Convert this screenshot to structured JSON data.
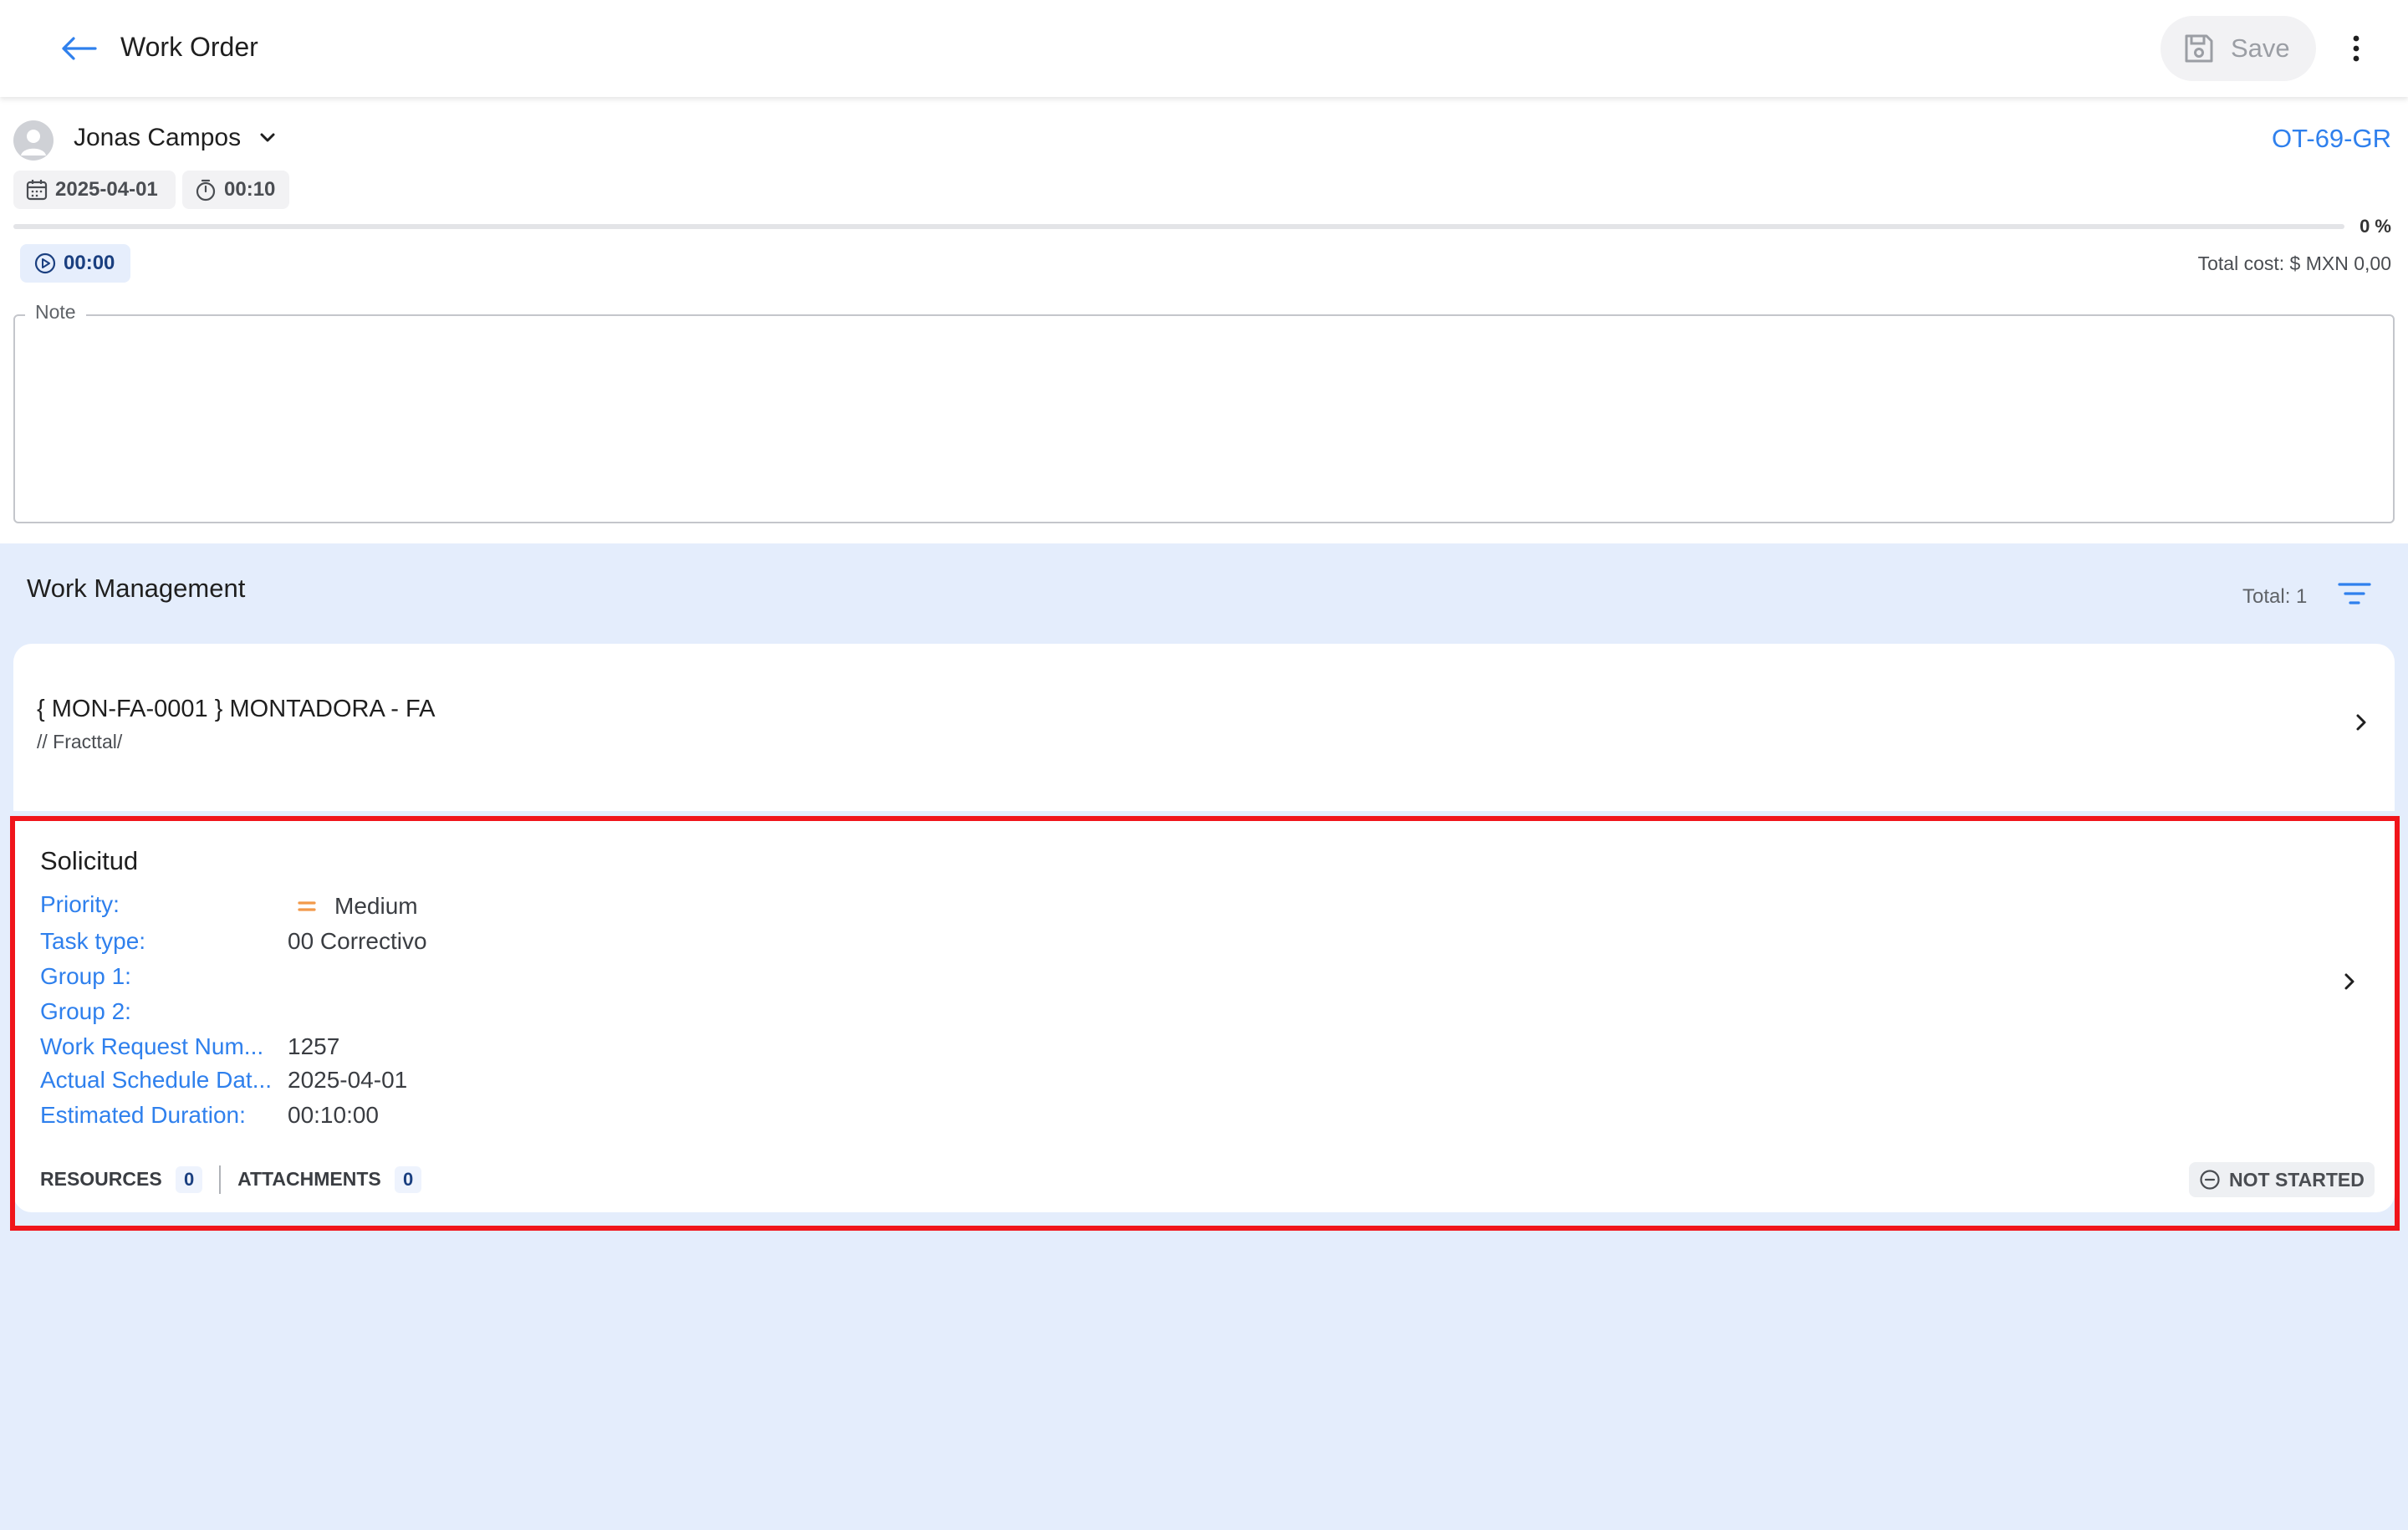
{
  "topbar": {
    "title": "Work Order",
    "save_label": "Save"
  },
  "header": {
    "assignee": "Jonas Campos",
    "work_order_code": "OT-69-GR",
    "date": "2025-04-01",
    "duration": "00:10",
    "progress_text": "0 %",
    "progress_fraction": 0,
    "timer": "00:00",
    "total_cost": "Total cost: $ MXN 0,00",
    "note_label": "Note",
    "note_value": ""
  },
  "work_management": {
    "title": "Work Management",
    "total": "Total: 1",
    "asset": {
      "name": "{ MON-FA-0001 } MONTADORA - FA",
      "path": "// Fracttal/"
    },
    "task": {
      "title": "Solicitud",
      "fields": [
        {
          "label": "Priority:",
          "value": "Medium"
        },
        {
          "label": "Task type:",
          "value": "00 Correctivo"
        },
        {
          "label": "Group 1:",
          "value": ""
        },
        {
          "label": "Group 2:",
          "value": ""
        },
        {
          "label": "Work Request Num...",
          "value": "1257"
        },
        {
          "label": "Actual Schedule Dat...",
          "value": "2025-04-01"
        },
        {
          "label": "Estimated Duration:",
          "value": "00:10:00"
        }
      ],
      "resources_label": "RESOURCES",
      "resources_count": "0",
      "attachments_label": "ATTACHMENTS",
      "attachments_count": "0",
      "status": "NOT STARTED"
    }
  },
  "colors": {
    "accent": "#2f80ed",
    "background": "#e4edfc",
    "priority_medium": "#f2994a",
    "highlight": "#f0151b"
  },
  "icons": {
    "back": "arrow-left-icon",
    "save": "floppy-disk-icon",
    "more": "more-vertical-icon",
    "avatar": "person-icon",
    "dropdown": "chevron-down-icon",
    "calendar": "calendar-icon",
    "stopwatch": "stopwatch-icon",
    "play": "play-circle-icon",
    "filter": "filter-lines-icon",
    "chevron": "chevron-right-icon",
    "priority": "equals-icon",
    "status": "minus-circle-icon"
  }
}
